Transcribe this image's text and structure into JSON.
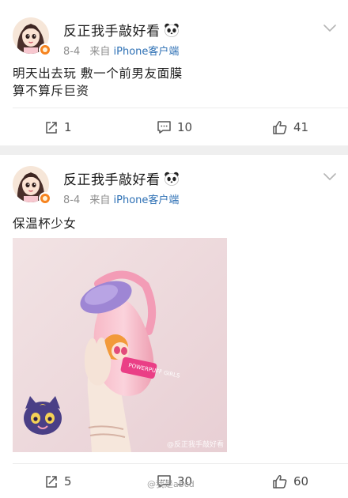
{
  "posts": [
    {
      "username": "反正我手敲好看",
      "date": "8-4",
      "source_prefix": "来自",
      "source_client": "iPhone客户端",
      "text": "明天出去玩  敷一个前男友面膜\n算不算斥巨资",
      "reposts": "1",
      "comments": "10",
      "likes": "41"
    },
    {
      "username": "反正我手敲好看",
      "date": "8-4",
      "source_prefix": "来自",
      "source_client": "iPhone客户端",
      "text": "保温杯少女",
      "reposts": "5",
      "comments": "30",
      "likes": "60",
      "photo_watermark": "@反正我手敲好看",
      "photo_bottle_label": "POWERPUFF GIRLS"
    }
  ],
  "bottom_watermark": "@我是abcd",
  "icons": {
    "emoji": "panda-icon",
    "menu": "chevron-down-icon",
    "repost": "repost-icon",
    "comment": "comment-icon",
    "like": "like-icon"
  },
  "colors": {
    "link": "#2c6fb4",
    "badge": "#f6831f",
    "meta": "#8d8d8d",
    "separator": "#efefef"
  }
}
